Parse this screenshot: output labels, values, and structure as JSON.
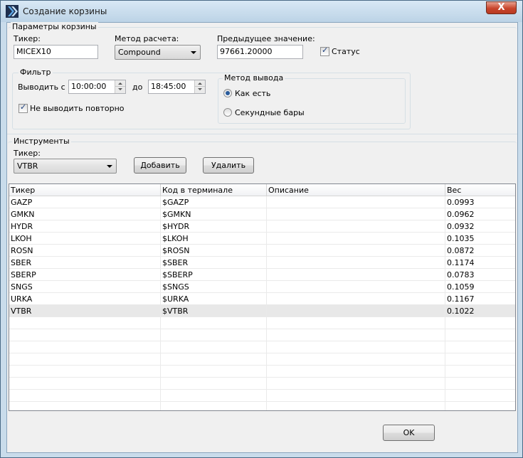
{
  "window": {
    "title": "Создание корзины",
    "close_label": "X"
  },
  "params": {
    "legend": "Параметры корзины",
    "ticker_label": "Тикер:",
    "ticker_value": "MICEX10",
    "method_label": "Метод расчета:",
    "method_value": "Compound",
    "prev_label": "Предыдущее значение:",
    "prev_value": "97661.20000",
    "status_label": "Статус",
    "status_checked": true
  },
  "filter": {
    "legend": "Фильтр",
    "from_label": "Выводить с",
    "from_value": "10:00:00",
    "to_label": "до",
    "to_value": "18:45:00",
    "no_repeat_label": "Не выводить повторно",
    "no_repeat_checked": true
  },
  "output": {
    "legend": "Метод вывода",
    "option_as_is": "Как есть",
    "option_second_bars": "Секундные бары",
    "selected": "as_is"
  },
  "instruments": {
    "legend": "Инструменты",
    "ticker_label": "Тикер:",
    "ticker_value": "VTBR",
    "add_label": "Добавить",
    "delete_label": "Удалить"
  },
  "table": {
    "columns": [
      "Тикер",
      "Код в терминале",
      "Описание",
      "Вес"
    ],
    "rows": [
      [
        "GAZP",
        "$GAZP",
        "",
        "0.0993"
      ],
      [
        "GMKN",
        "$GMKN",
        "",
        "0.0962"
      ],
      [
        "HYDR",
        "$HYDR",
        "",
        "0.0932"
      ],
      [
        "LKOH",
        "$LKOH",
        "",
        "0.1035"
      ],
      [
        "ROSN",
        "$ROSN",
        "",
        "0.0872"
      ],
      [
        "SBER",
        "$SBER",
        "",
        "0.1174"
      ],
      [
        "SBERP",
        "$SBERP",
        "",
        "0.0783"
      ],
      [
        "SNGS",
        "$SNGS",
        "",
        "0.1059"
      ],
      [
        "URKA",
        "$URKA",
        "",
        "0.1167"
      ],
      [
        "VTBR",
        "$VTBR",
        "",
        "0.1022"
      ]
    ],
    "selected_row": 9
  },
  "footer": {
    "ok_label": "OK"
  }
}
